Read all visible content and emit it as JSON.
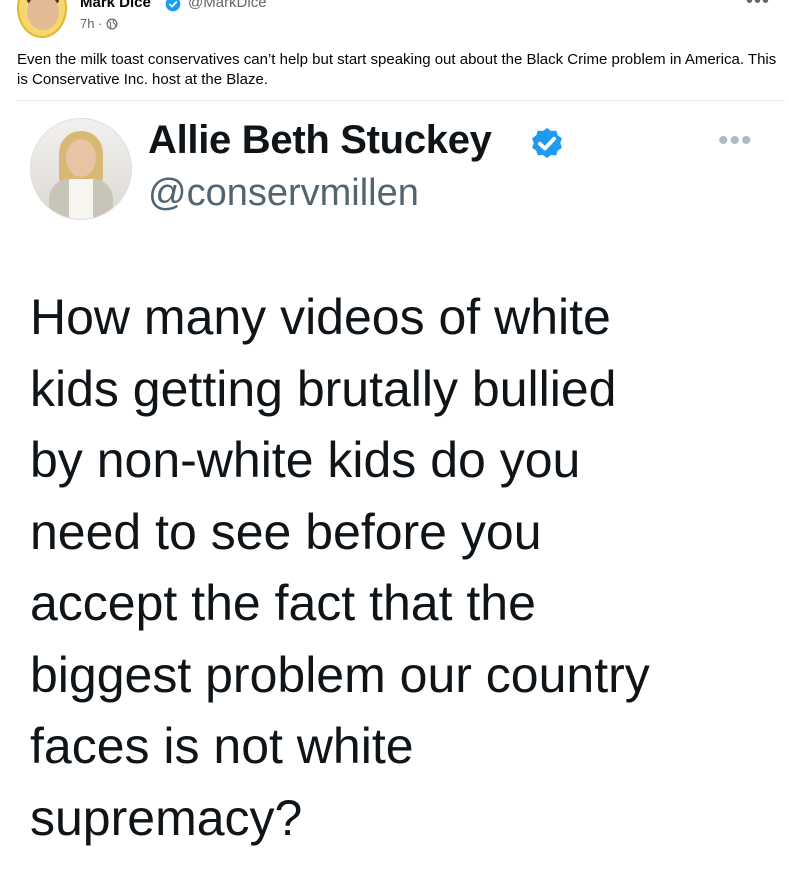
{
  "post": {
    "author_name": "Mark Dice",
    "author_handle": "@MarkDice",
    "timestamp": "7h",
    "separator": "·",
    "privacy_icon": "globe-icon",
    "more_label": "•••",
    "caption": "Even the milk toast conservatives can’t help but start speaking out about the Black Crime problem in America. This is Conservative Inc. host at the Blaze."
  },
  "tweet": {
    "name": "Allie Beth Stuckey",
    "handle": "@conservmillen",
    "verified_icon": "verified-badge-icon",
    "more_label": "•••",
    "text": "How many videos of white\nkids getting brutally bullied\nby non-white kids do you\nneed to see before you\naccept the fact that the\nbiggest problem our country\nfaces is not white\nsupremacy?"
  },
  "colors": {
    "verified_blue": "#1d9bf0",
    "secondary_text": "#65676b",
    "tweet_handle": "#536471"
  }
}
